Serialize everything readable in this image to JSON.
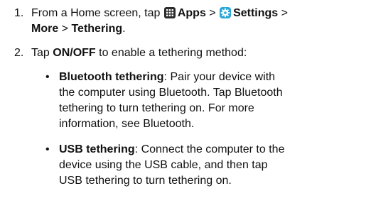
{
  "steps": [
    {
      "number": "1.",
      "from_text": "From a Home screen, tap ",
      "apps_label": "Apps",
      "sep1": " > ",
      "settings_label": "Settings",
      "sep2": " >",
      "more_label": "More",
      "sep3": " > ",
      "tethering_label": "Tethering",
      "end": "."
    },
    {
      "number": "2.",
      "text_pre": "Tap ",
      "onoff_label": "ON/OFF",
      "text_post": " to enable a tethering method:"
    }
  ],
  "bullets": [
    {
      "title": "Bluetooth tethering",
      "lines": [
        ": Pair your device with",
        "the computer using Bluetooth. Tap Bluetooth",
        "tethering to turn tethering on. For more",
        "information, see Bluetooth."
      ]
    },
    {
      "title": "USB tethering",
      "lines": [
        ": Connect the computer to the",
        "device using the USB cable, and then tap",
        "USB tethering to turn tethering on."
      ]
    }
  ],
  "bullet_char": "•",
  "icons": {
    "apps": "apps-grid-icon",
    "settings": "settings-gear-icon"
  },
  "colors": {
    "text": "#111111",
    "apps_icon": "#2b2b2b",
    "settings_icon_bg": "#2aa7d9"
  }
}
